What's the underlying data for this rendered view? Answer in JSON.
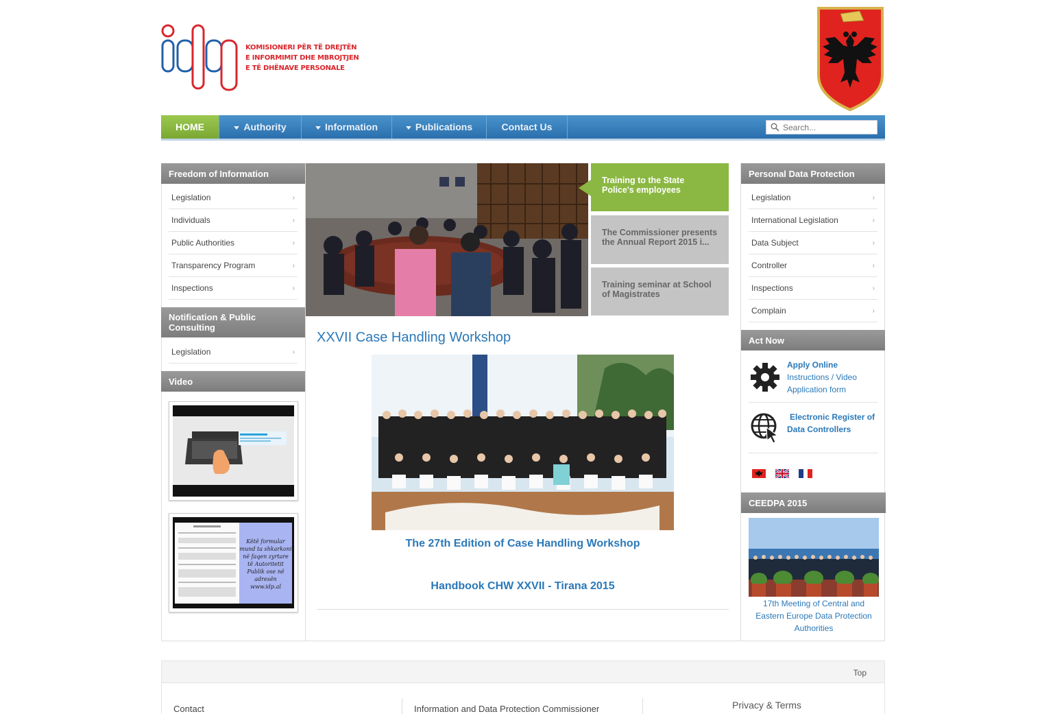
{
  "header": {
    "logo_lines": [
      "KOMISIONERI PËR TË DREJTËN",
      "E INFORMIMIT DHE MBROJTJEN",
      "E TË DHËNAVE PERSONALE"
    ]
  },
  "nav": {
    "items": [
      {
        "label": "HOME",
        "dropdown": false,
        "active": true
      },
      {
        "label": "Authority",
        "dropdown": true
      },
      {
        "label": "Information",
        "dropdown": true
      },
      {
        "label": "Publications",
        "dropdown": true
      },
      {
        "label": "Contact Us",
        "dropdown": false
      }
    ],
    "search_placeholder": "Search..."
  },
  "left": {
    "foi": {
      "title": "Freedom of Information",
      "items": [
        "Legislation",
        "Individuals",
        "Public Authorities",
        "Transparency Program",
        "Inspections"
      ]
    },
    "notification": {
      "title_line1": "Notification & Public",
      "title_line2": "Consulting",
      "items": [
        "Legislation"
      ]
    },
    "video": {
      "title": "Video",
      "thumb2_note": [
        "Këtë formular",
        "mund ta shkarkoni",
        "në faqen zyrtare",
        "të Autoritetit",
        "Publik ose në",
        "adresën",
        "www.idp.al"
      ]
    }
  },
  "slider": {
    "tabs": [
      {
        "label": "Training to the State Police's employees",
        "active": true
      },
      {
        "label": "The Commissioner presents the Annual Report 2015 i...",
        "active": false
      },
      {
        "label": "Training seminar at School of Magistrates",
        "active": false
      }
    ]
  },
  "article": {
    "title": "XXVII Case Handling Workshop",
    "link1": "The 27th Edition of Case Handling Workshop",
    "link2": "Handbook CHW XXVII - Tirana 2015"
  },
  "right": {
    "pdp": {
      "title": "Personal Data Protection",
      "items": [
        "Legislation",
        "International Legislation",
        "Data Subject",
        "Controller",
        "Inspections",
        "Complain"
      ]
    },
    "act_now": {
      "title": "Act Now",
      "apply_online": "Apply Online",
      "instructions": "Instructions",
      "slash": "/",
      "video": "Video",
      "application_form": "Application form",
      "register_line1": "Electronic Register of",
      "register_line2": "Data Controllers"
    },
    "ceedpa": {
      "title": "CEEDPA 2015",
      "caption": "17th Meeting of Central and Eastern Europe Data Protection Authorities"
    }
  },
  "footer": {
    "top_label": "Top",
    "contact": "Contact",
    "commissioner": "Information and Data Protection Commissioner",
    "privacy": "Privacy & Terms"
  },
  "colors": {
    "brand_blue": "#2a78b8",
    "nav_blue": "#3a83c0",
    "home_green": "#8bb842",
    "logo_red": "#d9262c",
    "panel_gray": "#8a8a8a"
  }
}
